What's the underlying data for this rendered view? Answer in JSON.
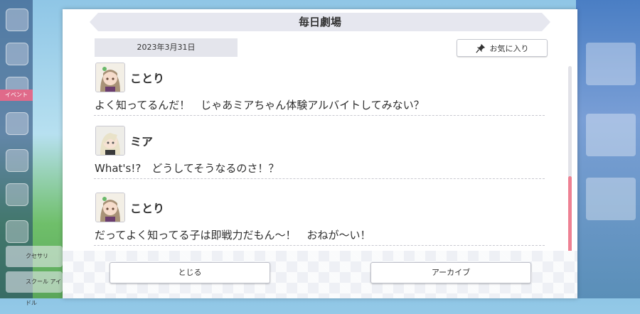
{
  "dialog": {
    "title": "毎日劇場",
    "date": "2023年3月31日",
    "favorite_label": "お気に入り",
    "close_label": "とじる",
    "archive_label": "アーカイブ"
  },
  "messages": [
    {
      "speaker": "ことり",
      "text": "よく知ってるんだ！　じゃあミアちゃん体験アルバイトしてみない？",
      "avatar": "kotori-avatar"
    },
    {
      "speaker": "ミア",
      "text": "What's!?　どうしてそうなるのさ！？",
      "avatar": "mia-avatar"
    },
    {
      "speaker": "ことり",
      "text": "だってよく知ってる子は即戦力だもん〜！　おねが〜い！",
      "avatar": "kotori-avatar"
    }
  ],
  "background": {
    "event_label": "イベント",
    "btn1": "クセサリ",
    "btn2": "スクール アイドル"
  },
  "colors": {
    "accent_scroll": "#ee8193",
    "panel_gray": "#e4e5ec"
  }
}
